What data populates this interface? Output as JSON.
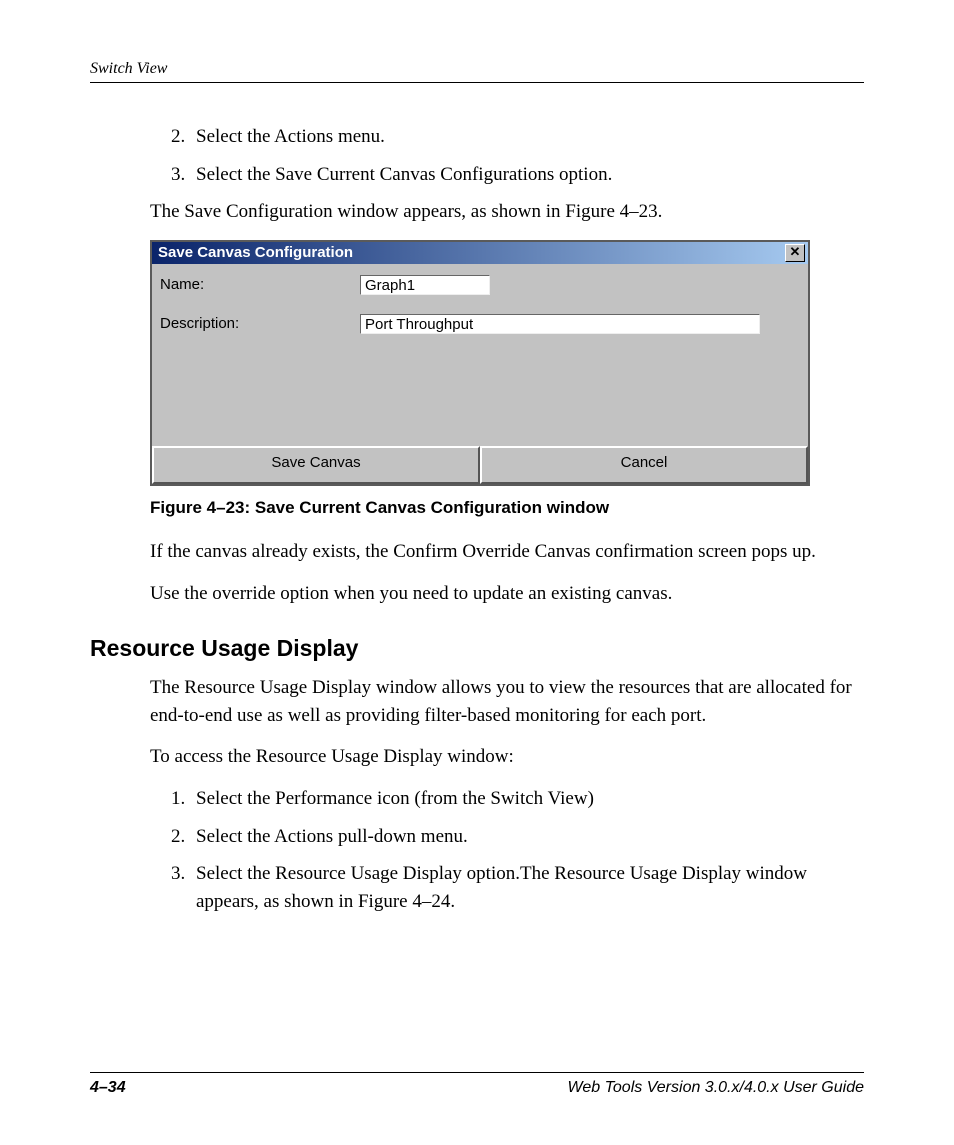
{
  "header": {
    "running_head": "Switch View"
  },
  "steps_a": {
    "start": 2,
    "items": [
      "Select the Actions menu.",
      "Select the Save Current Canvas Configurations option."
    ]
  },
  "para1": "The Save Configuration window appears, as shown in Figure 4–23.",
  "dialog": {
    "title": "Save Canvas Configuration",
    "close_glyph": "✕",
    "name_label": "Name:",
    "name_value": "Graph1",
    "desc_label": "Description:",
    "desc_value": "Port Throughput",
    "save_label": "Save Canvas",
    "cancel_label": "Cancel"
  },
  "figure_caption": "Figure 4–23:  Save Current Canvas Configuration window",
  "para2": "If the canvas already exists, the Confirm Override Canvas confirmation screen pops up.",
  "para3": "Use the override option when you need to update an existing canvas.",
  "section_heading": "Resource Usage Display",
  "para4": "The Resource Usage Display window allows you to view the resources that are allocated for end-to-end use as well as providing filter-based monitoring for each port.",
  "para5": "To access the Resource Usage Display window:",
  "steps_b": {
    "start": 1,
    "items": [
      "Select the Performance icon (from the Switch View)",
      "Select the Actions pull-down menu.",
      "Select the Resource Usage Display option.The Resource Usage Display window appears, as shown in Figure 4–24."
    ]
  },
  "footer": {
    "page_number": "4–34",
    "doc_title": "Web Tools Version 3.0.x/4.0.x User Guide"
  }
}
